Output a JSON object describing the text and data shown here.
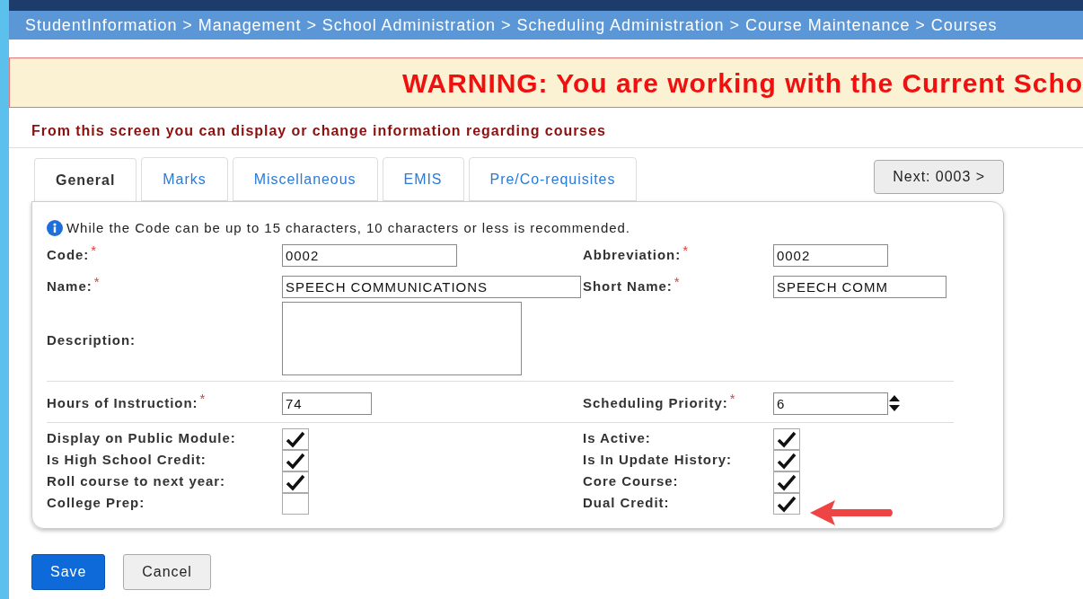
{
  "breadcrumb": "StudentInformation > Management > School Administration > Scheduling Administration > Course Maintenance > Courses",
  "warning": "WARNING: You are working with the Current Scho",
  "intro": "From this screen you can display or change information regarding courses",
  "tabs": [
    {
      "label": "General",
      "selected": true
    },
    {
      "label": "Marks",
      "selected": false
    },
    {
      "label": "Miscellaneous",
      "selected": false
    },
    {
      "label": "EMIS",
      "selected": false
    },
    {
      "label": "Pre/Co-requisites",
      "selected": false
    }
  ],
  "next_button": "Next: 0003 >",
  "info_note": "While the Code can be up to 15 characters, 10 characters or less is recommended.",
  "fields": [
    {
      "label": "Code:",
      "required_mark": "*",
      "value": "0002",
      "kind": "text"
    },
    {
      "label": "Abbreviation:",
      "required_mark": "*",
      "value": "0002",
      "kind": "text"
    },
    {
      "label": "Name:",
      "required_mark": "*",
      "value": "SPEECH COMMUNICATIONS",
      "kind": "text"
    },
    {
      "label": "Short Name:",
      "required_mark": "*",
      "value": "SPEECH COMM",
      "kind": "text"
    },
    {
      "label": "Description:",
      "kind": "textarea"
    }
  ],
  "numbers": [
    {
      "label": "Hours of Instruction:",
      "required_mark": "*",
      "value": "74",
      "kind": "text"
    },
    {
      "label": "Scheduling Priority:",
      "required_mark": "*",
      "value": "6",
      "kind": "spinner"
    }
  ],
  "flags": [
    {
      "label": "Display on Public Module:",
      "checked": true
    },
    {
      "label": "Is Active:",
      "checked": true
    },
    {
      "label": "Is High School Credit:",
      "checked": true
    },
    {
      "label": "Is In Update History:",
      "checked": true
    },
    {
      "label": "Roll course to next year:",
      "checked": true
    },
    {
      "label": "Core Course:",
      "checked": true
    },
    {
      "label": "College Prep:",
      "checked": false
    },
    {
      "label": "Dual Credit:",
      "checked": true
    }
  ],
  "buttons": [
    {
      "label": "Save",
      "kind": "primary"
    },
    {
      "label": "Cancel",
      "kind": "secondary"
    }
  ]
}
